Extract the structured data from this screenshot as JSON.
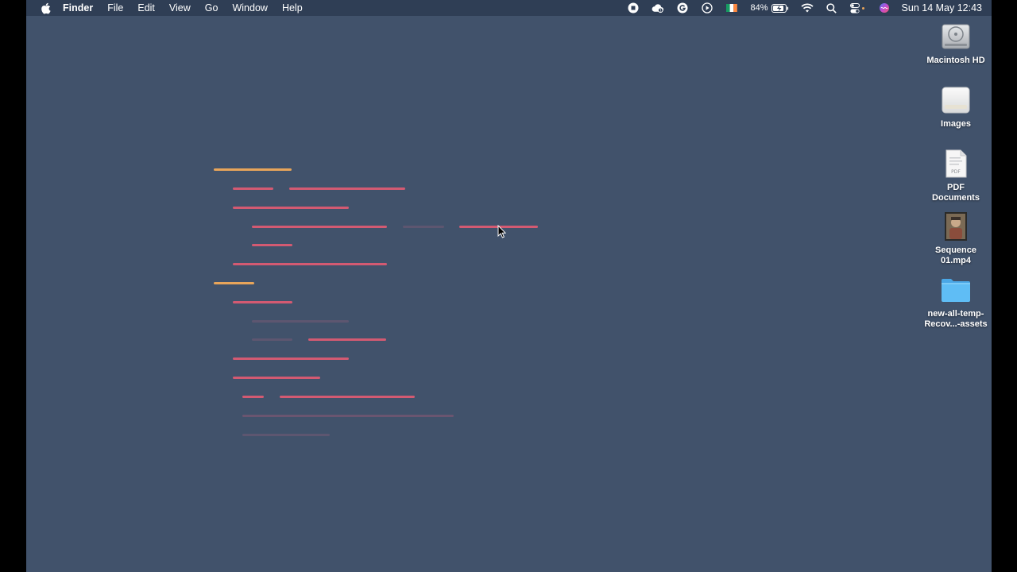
{
  "menubar": {
    "app_name": "Finder",
    "items": [
      "File",
      "Edit",
      "View",
      "Go",
      "Window",
      "Help"
    ],
    "battery_percent": "84%",
    "clock": "Sun 14 May  12:43"
  },
  "desktop_icons": [
    {
      "label": "Macintosh HD",
      "icon": "hard-drive-icon"
    },
    {
      "label": "Images",
      "icon": "drive-icon"
    },
    {
      "label": "PDF\nDocuments",
      "icon": "pdf-document-icon"
    },
    {
      "label": "Sequence\n01.mp4",
      "icon": "video-file-icon"
    },
    {
      "label": "new-all-temp-\nRecov...-assets",
      "icon": "folder-icon"
    }
  ],
  "colors": {
    "desktop": "#41526b",
    "menubar": "#2f3e55",
    "line_orange": "#e8a55a",
    "line_red": "#d35a72",
    "line_faint": "#6e5a6e"
  }
}
